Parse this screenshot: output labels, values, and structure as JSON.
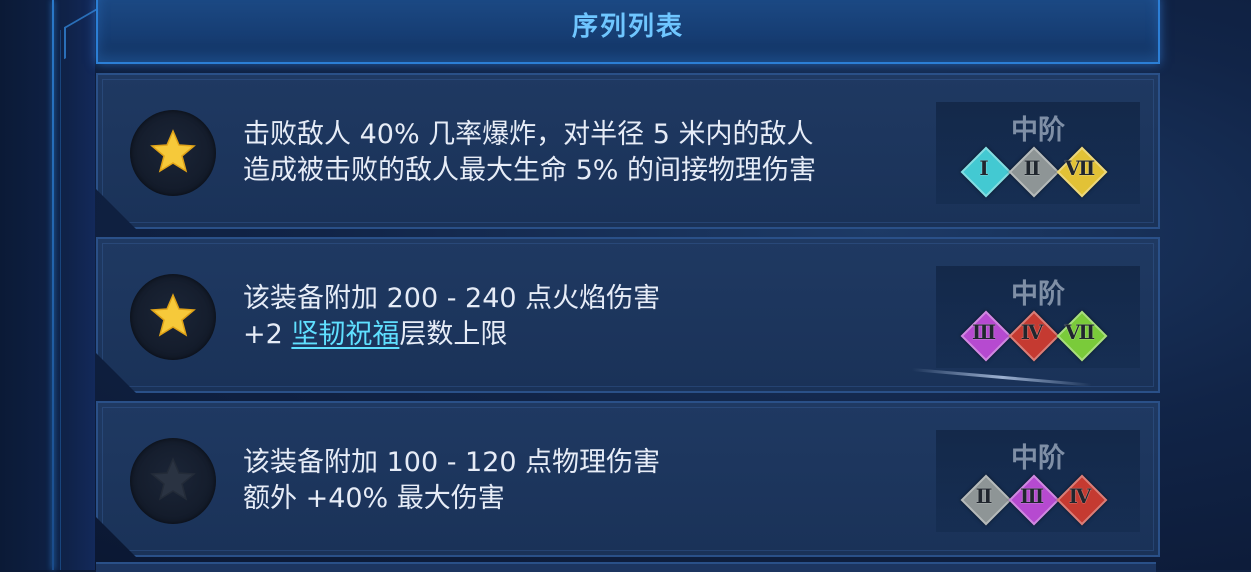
{
  "header": {
    "title": "序列列表"
  },
  "affixes": [
    {
      "line1": "击败敌人 40% 几率爆炸，对半径 5 米内的敌人",
      "line2_pre": "造成被击败的敌人最大生命 5% 的间接物理伤害",
      "line2_highlight": "",
      "line2_post": "",
      "star": "gold-star-icon",
      "tier": "中阶",
      "gems": [
        {
          "numeral": "Ⅰ",
          "color": "#43c9d2"
        },
        {
          "numeral": "Ⅱ",
          "color": "#8e9596"
        },
        {
          "numeral": "Ⅶ",
          "color": "#e2c236"
        }
      ]
    },
    {
      "line1": "该装备附加 200 - 240 点火焰伤害",
      "line2_pre": "+2 ",
      "line2_highlight": "坚韧祝福",
      "line2_post": "层数上限",
      "star": "gold-star-icon",
      "tier": "中阶",
      "gems": [
        {
          "numeral": "Ⅲ",
          "color": "#b64ad0"
        },
        {
          "numeral": "Ⅳ",
          "color": "#c53a31"
        },
        {
          "numeral": "Ⅶ",
          "color": "#7acb3a"
        }
      ]
    },
    {
      "line1": "该装备附加 100 - 120 点物理伤害",
      "line2_pre": "额外 +40% 最大伤害",
      "line2_highlight": "",
      "line2_post": "",
      "star": "dim-star-icon",
      "tier": "中阶",
      "gems": [
        {
          "numeral": "Ⅱ",
          "color": "#8e9596"
        },
        {
          "numeral": "Ⅲ",
          "color": "#b64ad0"
        },
        {
          "numeral": "Ⅳ",
          "color": "#c53a31"
        }
      ]
    }
  ],
  "colors": {
    "gold_star": "#f6c93a",
    "dim_star": "#2a3342",
    "highlight": "#5fe0ff",
    "title": "#6fc6ff"
  }
}
